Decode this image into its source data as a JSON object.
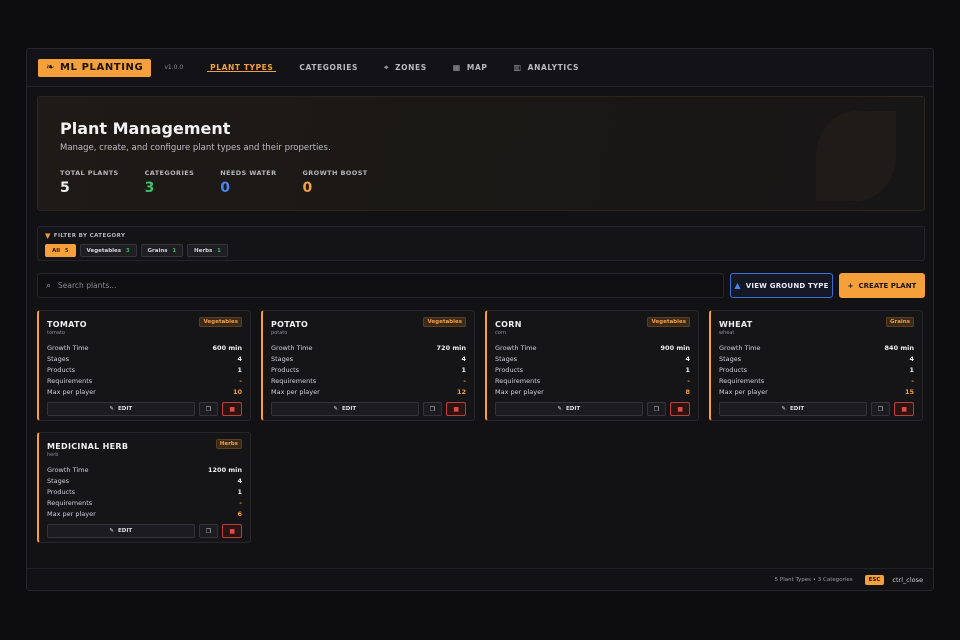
{
  "app": {
    "logo": "ML PLANTING",
    "version": "v1.0.0"
  },
  "nav": [
    {
      "label": "PLANT TYPES",
      "icon": "",
      "active": true
    },
    {
      "label": "CATEGORIES",
      "icon": "",
      "active": false
    },
    {
      "label": "ZONES",
      "icon": "⌖",
      "active": false
    },
    {
      "label": "MAP",
      "icon": "▦",
      "active": false
    },
    {
      "label": "ANALYTICS",
      "icon": "▥",
      "active": false
    }
  ],
  "hero": {
    "title": "Plant Management",
    "subtitle": "Manage, create, and configure plant types and their properties.",
    "stats": [
      {
        "label": "TOTAL PLANTS",
        "value": "5",
        "color": "#f2f2f2"
      },
      {
        "label": "CATEGORIES",
        "value": "3",
        "color": "#3fbf6a"
      },
      {
        "label": "NEEDS WATER",
        "value": "0",
        "color": "#4a84f0"
      },
      {
        "label": "GROWTH BOOST",
        "value": "0",
        "color": "#f5a03a"
      }
    ]
  },
  "filter": {
    "label": "FILTER BY CATEGORY",
    "chips": [
      {
        "label": "All",
        "count": "5",
        "active": true
      },
      {
        "label": "Vegetables",
        "count": "3",
        "active": false
      },
      {
        "label": "Grains",
        "count": "1",
        "active": false
      },
      {
        "label": "Herbs",
        "count": "1",
        "active": false
      }
    ]
  },
  "search": {
    "placeholder": "Search plants..."
  },
  "actions": {
    "ground": "VIEW GROUND TYPE",
    "create": "CREATE PLANT"
  },
  "row_labels": {
    "growth": "Growth Time",
    "stages": "Stages",
    "products": "Products",
    "requirements": "Requirements",
    "max": "Max per player"
  },
  "edit_label": "EDIT",
  "plants": [
    {
      "name": "TOMATO",
      "id": "tomato",
      "category": "Vegetables",
      "growth": "600 min",
      "stages": "4",
      "products": "1",
      "requirements": "-",
      "max": "10"
    },
    {
      "name": "POTATO",
      "id": "potato",
      "category": "Vegetables",
      "growth": "720 min",
      "stages": "4",
      "products": "1",
      "requirements": "-",
      "max": "12"
    },
    {
      "name": "CORN",
      "id": "corn",
      "category": "Vegetables",
      "growth": "900 min",
      "stages": "4",
      "products": "1",
      "requirements": "-",
      "max": "8"
    },
    {
      "name": "WHEAT",
      "id": "wheat",
      "category": "Grains",
      "growth": "840 min",
      "stages": "4",
      "products": "1",
      "requirements": "-",
      "max": "15"
    },
    {
      "name": "MEDICINAL HERB",
      "id": "herb",
      "category": "Herbs",
      "growth": "1200 min",
      "stages": "4",
      "products": "1",
      "requirements": "-",
      "max": "6"
    }
  ],
  "footer": {
    "summary": "5 Plant Types • 3 Categories",
    "key": "ESC",
    "hint": "ctrl_close"
  }
}
